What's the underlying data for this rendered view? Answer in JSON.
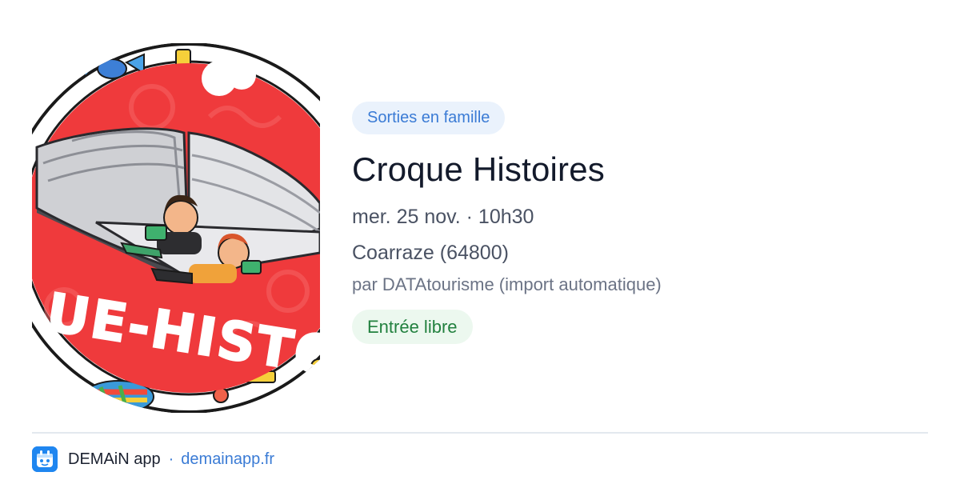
{
  "event": {
    "image_alt": "Croque Histoires illustration",
    "image_text": "UE-HISTO",
    "category": "Sorties en famille",
    "title": "Croque Histoires",
    "datetime": "mer. 25 nov. · 10h30",
    "location": "Coarraze (64800)",
    "source": "par DATAtourisme (import automatique)",
    "price": "Entrée libre"
  },
  "footer": {
    "app_icon": "demain-app-icon",
    "app_name": "DEMAiN app",
    "separator": "·",
    "app_url": "demainapp.fr"
  },
  "colors": {
    "category_bg": "#eaf2fc",
    "category_text": "#3a7bd5",
    "price_bg": "#ecf8ef",
    "price_text": "#22813f",
    "title_text": "#131a2b",
    "link": "#3a7bd5",
    "image_red": "#ef3a3c"
  }
}
